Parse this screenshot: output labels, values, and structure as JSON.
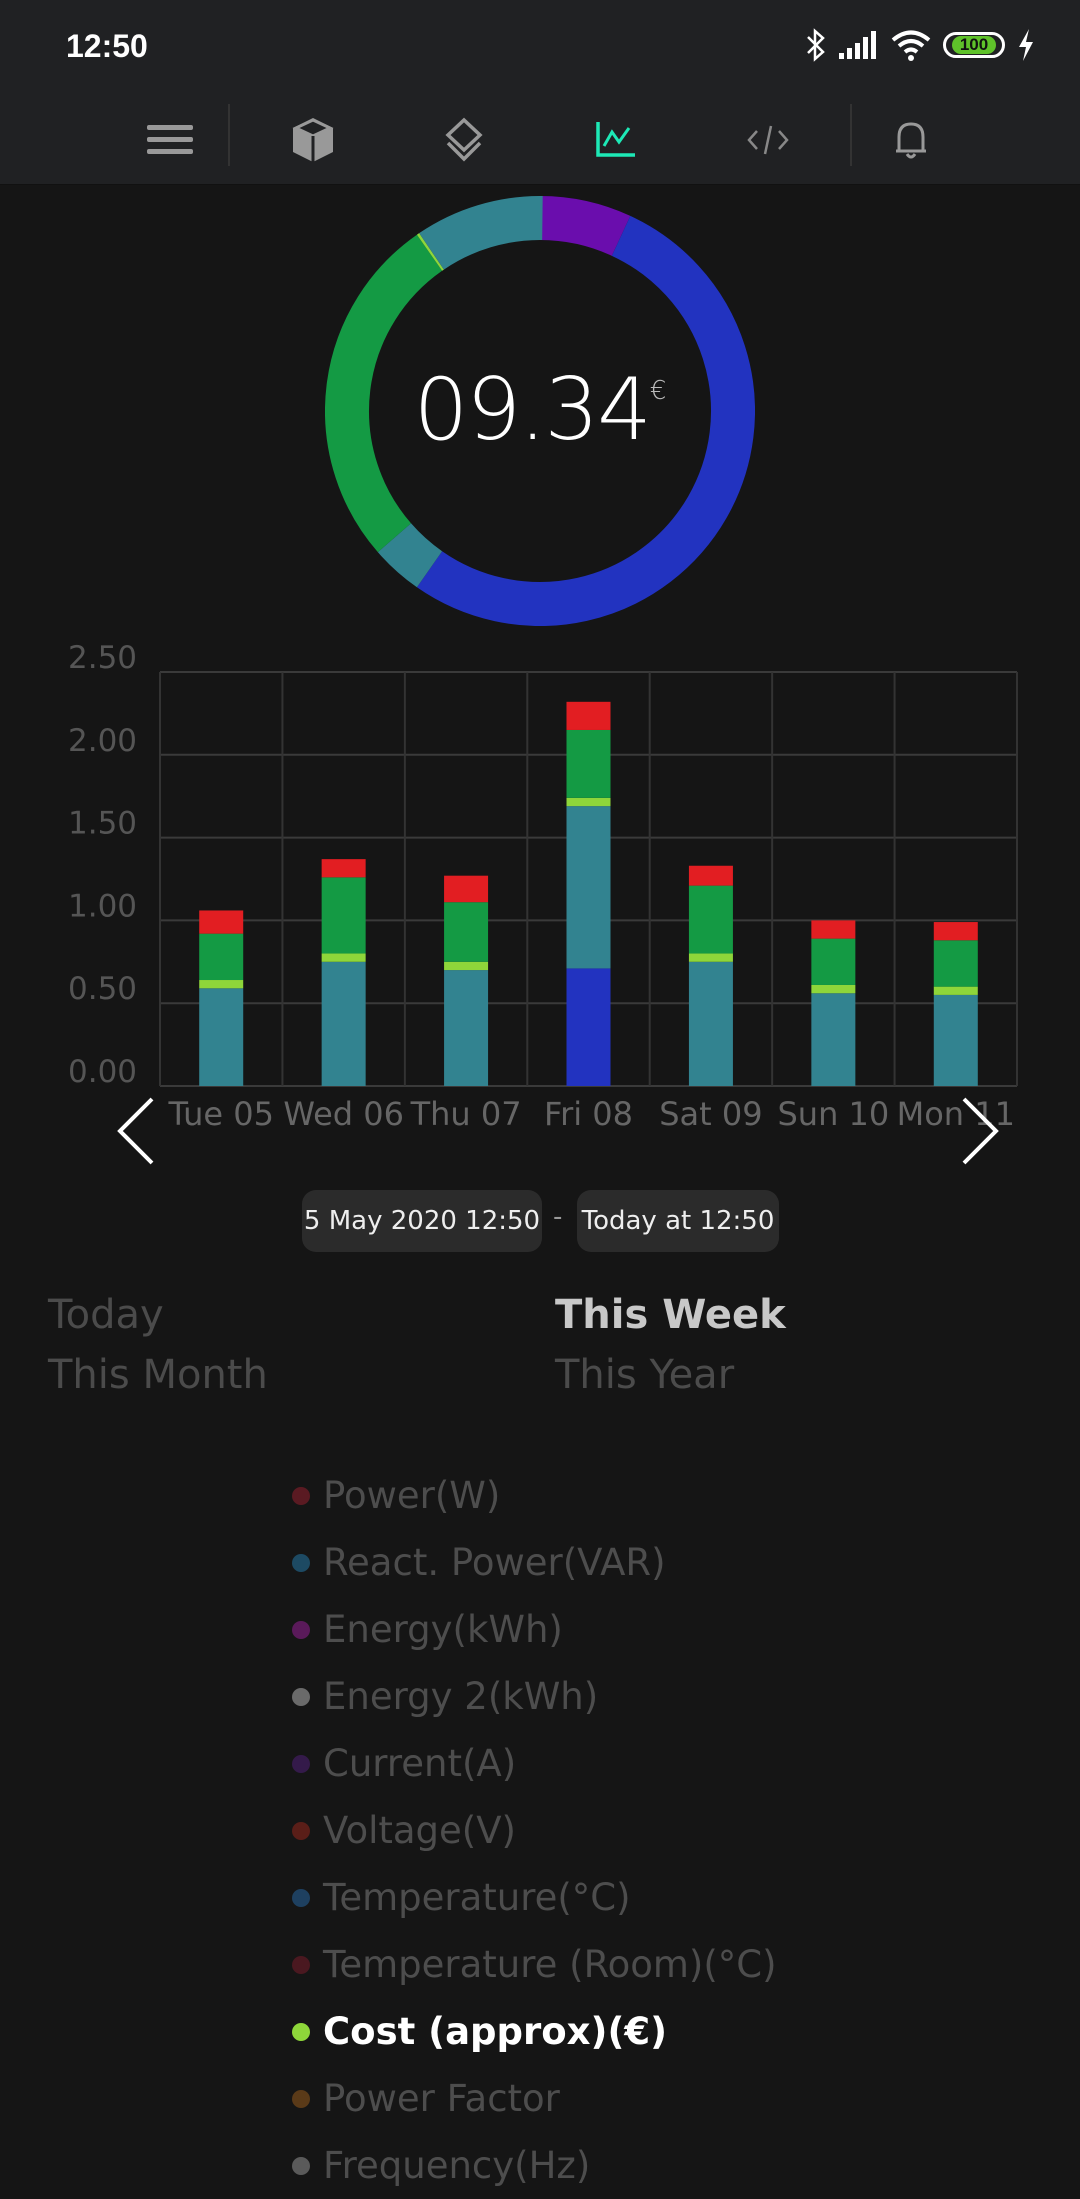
{
  "status_bar": {
    "time": "12:50",
    "battery": "100"
  },
  "toolbar": {
    "items": [
      {
        "name": "menu",
        "icon": "hamburger-menu-icon",
        "active": false
      },
      {
        "name": "devices",
        "icon": "cube-icon",
        "active": false
      },
      {
        "name": "layers",
        "icon": "layers-icon",
        "active": false
      },
      {
        "name": "charts",
        "icon": "line-chart-icon",
        "active": true
      },
      {
        "name": "code",
        "icon": "code-icon",
        "active": false
      },
      {
        "name": "notifications",
        "icon": "bell-icon",
        "active": false
      }
    ],
    "accent": "#1de9b6"
  },
  "summary": {
    "total": "09.34",
    "currency": "€"
  },
  "chart_data": [
    {
      "type": "pie",
      "variant": "donut",
      "slices": [
        {
          "value": 0.069,
          "color": "#6a0dad"
        },
        {
          "value": 0.528,
          "color": "#2233c0"
        },
        {
          "value": 0.039,
          "color": "#328390"
        },
        {
          "value": 0.267,
          "color": "#149a44"
        },
        {
          "value": 0.002,
          "color": "#8ed63a"
        },
        {
          "value": 0.097,
          "color": "#328390"
        }
      ]
    },
    {
      "type": "bar",
      "stacked": true,
      "categories": [
        "Tue 05",
        "Wed 06",
        "Thu 07",
        "Fri 08",
        "Sat 09",
        "Sun 10",
        "Mon 11"
      ],
      "ylim": [
        0,
        2.5
      ],
      "yticks": [
        "0.00",
        "0.50",
        "1.00",
        "1.50",
        "2.00",
        "2.50"
      ],
      "grid": true,
      "series": [
        {
          "color": "#2233c0",
          "values": [
            0,
            0,
            0,
            0.71,
            0,
            0,
            0
          ]
        },
        {
          "color": "#328390",
          "values": [
            0.59,
            0.75,
            0.7,
            0.98,
            0.75,
            0.56,
            0.55
          ]
        },
        {
          "color": "#8ed63a",
          "values": [
            0.05,
            0.05,
            0.05,
            0.05,
            0.05,
            0.05,
            0.05
          ]
        },
        {
          "color": "#149a44",
          "values": [
            0.28,
            0.46,
            0.36,
            0.41,
            0.41,
            0.28,
            0.28
          ]
        },
        {
          "color": "#e21e22",
          "values": [
            0.14,
            0.11,
            0.16,
            0.17,
            0.12,
            0.11,
            0.11
          ]
        }
      ]
    }
  ],
  "date_range": {
    "from": "5 May 2020 12:50",
    "separator": "-",
    "to": "Today at 12:50"
  },
  "ranges": [
    {
      "label": "Today",
      "active": false
    },
    {
      "label": "This Week",
      "active": true
    },
    {
      "label": "This Month",
      "active": false
    },
    {
      "label": "This Year",
      "active": false
    }
  ],
  "legend": [
    {
      "label": "Power(W)",
      "color": "#5a1a22",
      "active": false
    },
    {
      "label": "React. Power(VAR)",
      "color": "#1d4a63",
      "active": false
    },
    {
      "label": "Energy(kWh)",
      "color": "#5a1a5a",
      "active": false
    },
    {
      "label": "Energy 2(kWh)",
      "color": "#6a6a6a",
      "active": false
    },
    {
      "label": "Current(A)",
      "color": "#341a4a",
      "active": false
    },
    {
      "label": "Voltage(V)",
      "color": "#5a1e18",
      "active": false
    },
    {
      "label": "Temperature(°C)",
      "color": "#1e4060",
      "active": false
    },
    {
      "label": "Temperature (Room)(°C)",
      "color": "#4a1820",
      "active": false
    },
    {
      "label": "Cost (approx)(€)",
      "color": "#8ed63a",
      "active": true
    },
    {
      "label": "Power Factor",
      "color": "#5a3a18",
      "active": false
    },
    {
      "label": "Frequency(Hz)",
      "color": "#5a5a5a",
      "active": false
    }
  ]
}
